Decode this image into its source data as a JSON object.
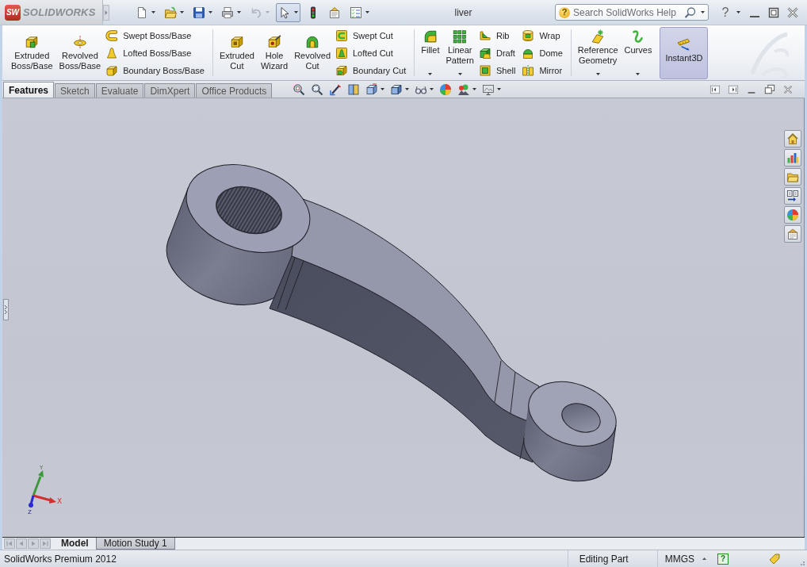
{
  "title_bar": {
    "logo_mark": "SW",
    "app_name": "SOLIDWORKS",
    "quick_access": [
      {
        "dropdown": true,
        "disabled": false,
        "pressed": false
      },
      {
        "dropdown": true,
        "disabled": false,
        "pressed": false
      },
      {
        "dropdown": true,
        "disabled": false,
        "pressed": false
      },
      {
        "dropdown": true,
        "disabled": false,
        "pressed": false
      },
      {
        "dropdown": true,
        "disabled": true,
        "pressed": false
      },
      {
        "dropdown": true,
        "disabled": false,
        "pressed": true
      },
      {
        "dropdown": false,
        "disabled": false,
        "pressed": false
      },
      {
        "dropdown": false,
        "disabled": false,
        "pressed": false
      },
      {
        "dropdown": true,
        "disabled": false,
        "pressed": false
      }
    ],
    "document_title": "liver",
    "search": {
      "help_glyph": "?",
      "placeholder": "Search SolidWorks Help"
    },
    "help_glyph": "?"
  },
  "ribbon": {
    "groups": [
      {
        "items": [
          {
            "kind": "large",
            "label": "Extruded Boss/Base",
            "dropdown": false
          },
          {
            "kind": "large",
            "label": "Revolved Boss/Base",
            "dropdown": false
          },
          {
            "kind": "stack",
            "entries": [
              "Swept Boss/Base",
              "Lofted Boss/Base",
              "Boundary Boss/Base"
            ]
          }
        ]
      },
      {
        "items": [
          {
            "kind": "large",
            "label": "Extruded Cut",
            "dropdown": false
          },
          {
            "kind": "large",
            "label": "Hole Wizard",
            "dropdown": false
          },
          {
            "kind": "large",
            "label": "Revolved Cut",
            "dropdown": false
          },
          {
            "kind": "stack",
            "entries": [
              "Swept Cut",
              "Lofted Cut",
              "Boundary Cut"
            ]
          }
        ]
      },
      {
        "items": [
          {
            "kind": "large",
            "label": "Fillet",
            "dropdown": true
          },
          {
            "kind": "large",
            "label": "Linear Pattern",
            "dropdown": true
          },
          {
            "kind": "stack",
            "entries": [
              "Rib",
              "Draft",
              "Shell"
            ]
          },
          {
            "kind": "stack",
            "entries": [
              "Wrap",
              "Dome",
              "Mirror"
            ]
          }
        ]
      },
      {
        "items": [
          {
            "kind": "large",
            "label": "Reference Geometry",
            "dropdown": true
          },
          {
            "kind": "large",
            "label": "Curves",
            "dropdown": true
          },
          {
            "kind": "toggle",
            "label": "Instant3D",
            "on": true
          }
        ]
      }
    ]
  },
  "command_tabs": [
    {
      "label": "Features",
      "selected": true
    },
    {
      "label": "Sketch",
      "selected": false
    },
    {
      "label": "Evaluate",
      "selected": false
    },
    {
      "label": "DimXpert",
      "selected": false
    },
    {
      "label": "Office Products",
      "selected": false
    }
  ],
  "view_toolbar": [
    {
      "dropdown": false
    },
    {
      "dropdown": false
    },
    {
      "dropdown": false
    },
    {
      "dropdown": false
    },
    {
      "dropdown": true
    },
    {
      "dropdown": true
    },
    {
      "dropdown": true
    },
    {
      "dropdown": false
    },
    {
      "dropdown": true
    },
    {
      "dropdown": true
    }
  ],
  "triad": {
    "x_label": "X",
    "y_label": "Y",
    "z_label": "Z"
  },
  "bottom_tabs": [
    {
      "label": "Model",
      "selected": true
    },
    {
      "label": "Motion Study 1",
      "selected": false
    }
  ],
  "status_bar": {
    "product": "SolidWorks Premium 2012",
    "mode": "Editing Part",
    "units": "MMGS",
    "help_glyph": "?"
  }
}
